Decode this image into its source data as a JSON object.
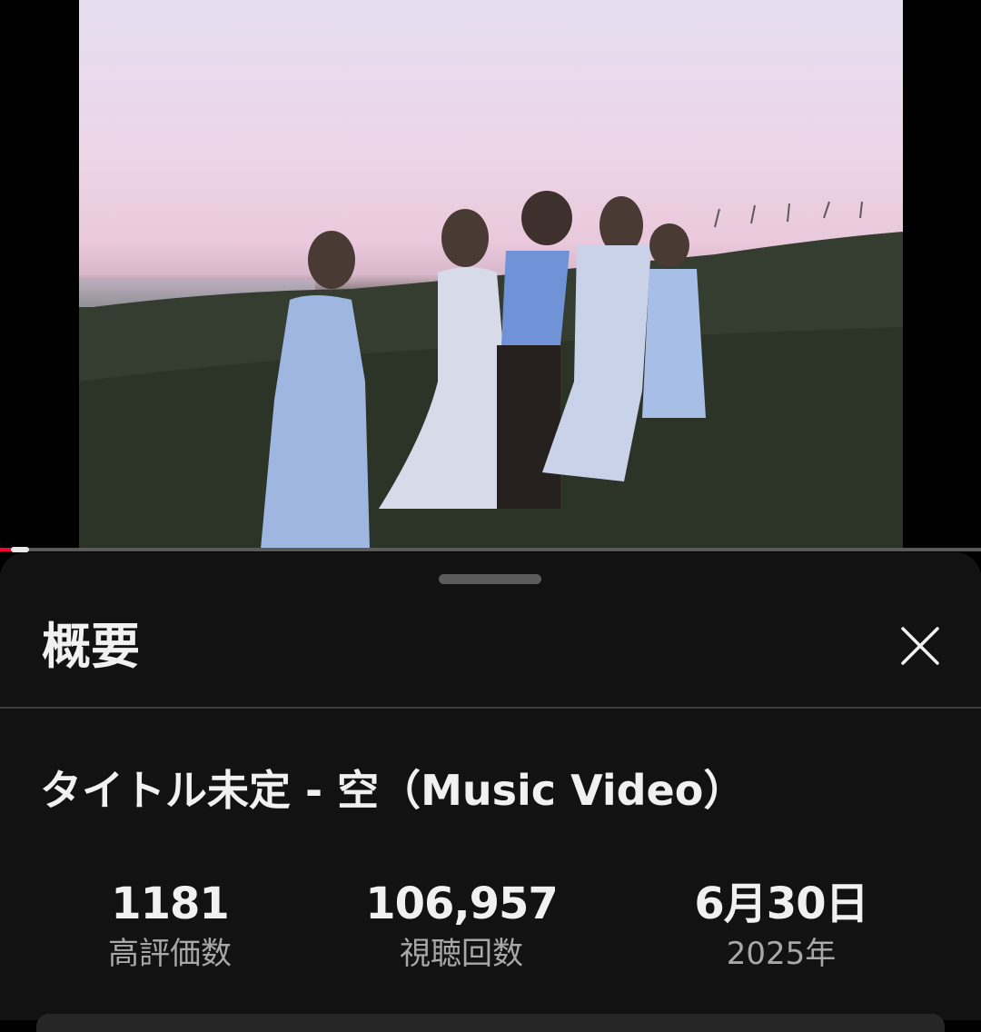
{
  "sheet": {
    "title": "概要",
    "close_icon": "close-icon"
  },
  "video": {
    "title": "タイトル未定 - 空（Music Video）",
    "progress_fraction": 0.02
  },
  "stats": {
    "likes": {
      "value": "1181",
      "label": "高評価数"
    },
    "views": {
      "value": "106,957",
      "label": "視聴回数"
    },
    "date": {
      "value": "6月30日",
      "label": "2025年"
    }
  },
  "colors": {
    "sheet_bg": "#121212",
    "progress_accent": "#ff0033"
  }
}
